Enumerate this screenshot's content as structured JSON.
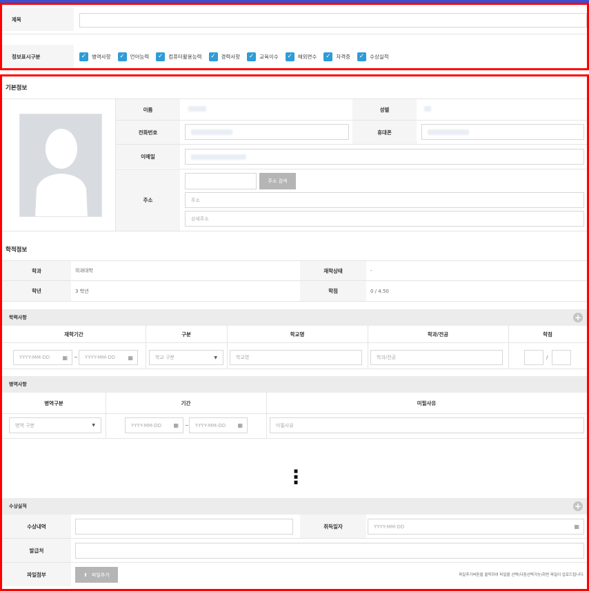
{
  "form": {
    "title_label": "제목",
    "display_label": "정보표시구분",
    "checkboxes": [
      {
        "label": "병역사항",
        "checked": true
      },
      {
        "label": "언어능력",
        "checked": true
      },
      {
        "label": "컴퓨터활용능력",
        "checked": true
      },
      {
        "label": "경력사항",
        "checked": true
      },
      {
        "label": "교육이수",
        "checked": true
      },
      {
        "label": "해외연수",
        "checked": true
      },
      {
        "label": "자격증",
        "checked": true
      },
      {
        "label": "수상실적",
        "checked": true
      }
    ]
  },
  "basic": {
    "title": "기본정보",
    "name_label": "이름",
    "gender_label": "성별",
    "phone_label": "전화번호",
    "mobile_label": "휴대폰",
    "email_label": "이메일",
    "address_label": "주소",
    "address_search_button": "주소 검색",
    "address_placeholder": "주소",
    "address_detail_placeholder": "상세주소"
  },
  "academic": {
    "title": "학적정보",
    "dept_label": "학과",
    "dept_value": "의과대학",
    "status_label": "재학상태",
    "status_value": "-",
    "grade_label": "학년",
    "grade_value": "3 학년",
    "credit_label": "학점",
    "credit_value": "0 / 4.50"
  },
  "education": {
    "title": "학력사항",
    "columns": [
      "재학기간",
      "구분",
      "학교명",
      "학과/전공",
      "학점"
    ],
    "date_placeholder": "YYYY-MM-DD",
    "tilde": "~",
    "school_type_placeholder": "학교 구분",
    "school_name_placeholder": "학교명",
    "major_placeholder": "학과/전공",
    "slash": "/"
  },
  "military": {
    "title": "병역사항",
    "columns": [
      "병역구분",
      "기간",
      "미필사유"
    ],
    "type_placeholder": "병역 구분",
    "date_placeholder": "YYYY-MM-DD",
    "tilde": "~",
    "reason_placeholder": "미필사유"
  },
  "ellipsis": "⋮",
  "awards": {
    "title": "수상실적",
    "award_label": "수상내역",
    "date_label": "취득일자",
    "date_placeholder": "YYYY-MM-DD",
    "issuer_label": "발급처",
    "file_label": "파일첨부",
    "file_button": "파일추가",
    "file_hint": "파일추가버튼을 클릭하여 파일을 선택(다중선택가능)하면 파일이 업로드됩니다."
  },
  "icons": {
    "check": "✓",
    "plus": "+",
    "calendar": "▦",
    "caret": "▼",
    "upload": "⬆"
  },
  "colors": {
    "accent_border": "#ff0000",
    "checkbox": "#2e9cd6",
    "top_bar": "#3b4fd0"
  }
}
